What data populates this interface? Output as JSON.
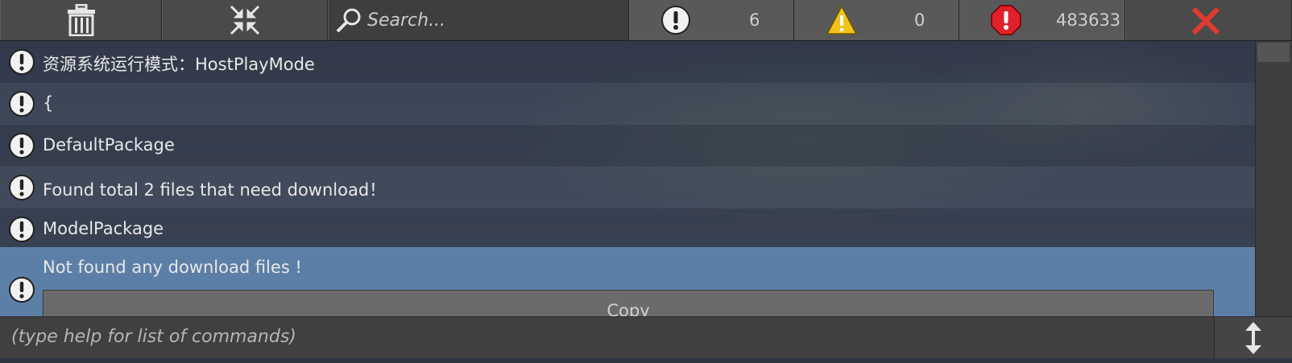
{
  "toolbar": {
    "clear_icon": "trash-icon",
    "collapse_icon": "collapse-icon",
    "search": {
      "placeholder": "Search...",
      "icon": "search-icon"
    },
    "info": {
      "icon": "info-icon",
      "count": "6"
    },
    "warning": {
      "icon": "warning-icon",
      "count": "0"
    },
    "error": {
      "icon": "error-icon",
      "count": "483633"
    },
    "close_icon": "close-icon"
  },
  "log": {
    "entries": [
      {
        "type": "info",
        "text": "资源系统运行模式：HostPlayMode"
      },
      {
        "type": "info",
        "text": "{"
      },
      {
        "type": "info",
        "text": "DefaultPackage"
      },
      {
        "type": "info",
        "text": "Found total 2 files that need download！"
      },
      {
        "type": "info",
        "text": "ModelPackage"
      },
      {
        "type": "info",
        "text": "Not found any download files !",
        "selected": true
      }
    ],
    "copy_label": "Copy"
  },
  "command": {
    "placeholder": "(type help for list of commands)",
    "resize_icon": "resize-vertical-icon"
  },
  "colors": {
    "selected_row": "#5c7fa8",
    "error_red": "#e0202a",
    "warning_yellow": "#f2c21b",
    "close_red": "#e23a2e"
  }
}
